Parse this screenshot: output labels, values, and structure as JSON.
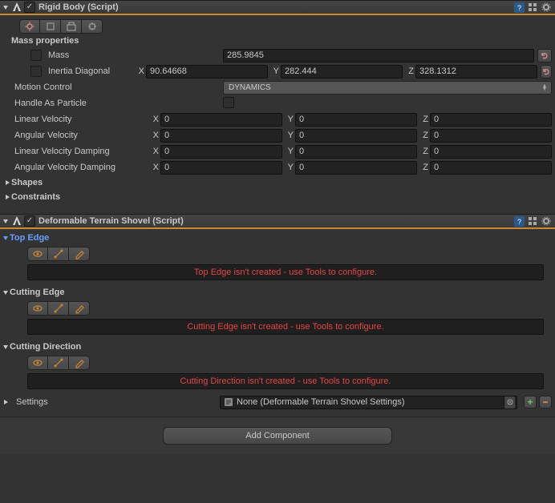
{
  "rigid_body": {
    "title": "Rigid Body (Script)",
    "mass_header": "Mass properties",
    "mass_label": "Mass",
    "mass_value": "285.9845",
    "inertia_label": "Inertia Diagonal",
    "inertia": {
      "x": "90.64668",
      "y": "282.444",
      "z": "328.1312"
    },
    "motion_label": "Motion Control",
    "motion_value": "DYNAMICS",
    "particle_label": "Handle As Particle",
    "lin_vel_label": "Linear Velocity",
    "lin_vel": {
      "x": "0",
      "y": "0",
      "z": "0"
    },
    "ang_vel_label": "Angular Velocity",
    "ang_vel": {
      "x": "0",
      "y": "0",
      "z": "0"
    },
    "lin_damp_label": "Linear Velocity Damping",
    "lin_damp": {
      "x": "0",
      "y": "0",
      "z": "0"
    },
    "ang_damp_label": "Angular Velocity Damping",
    "ang_damp": {
      "x": "0",
      "y": "0",
      "z": "0"
    },
    "shapes_label": "Shapes",
    "constraints_label": "Constraints",
    "axis": {
      "x": "X",
      "y": "Y",
      "z": "Z"
    }
  },
  "shovel": {
    "title": "Deformable Terrain Shovel (Script)",
    "top_edge": {
      "label": "Top Edge",
      "error": "Top Edge isn't created - use Tools to configure."
    },
    "cutting_edge": {
      "label": "Cutting Edge",
      "error": "Cutting Edge isn't created - use Tools to configure."
    },
    "cutting_dir": {
      "label": "Cutting Direction",
      "error": "Cutting Direction isn't created - use Tools to configure."
    },
    "settings_label": "Settings",
    "settings_value": "None (Deformable Terrain Shovel Settings)"
  },
  "add_component": "Add Component"
}
